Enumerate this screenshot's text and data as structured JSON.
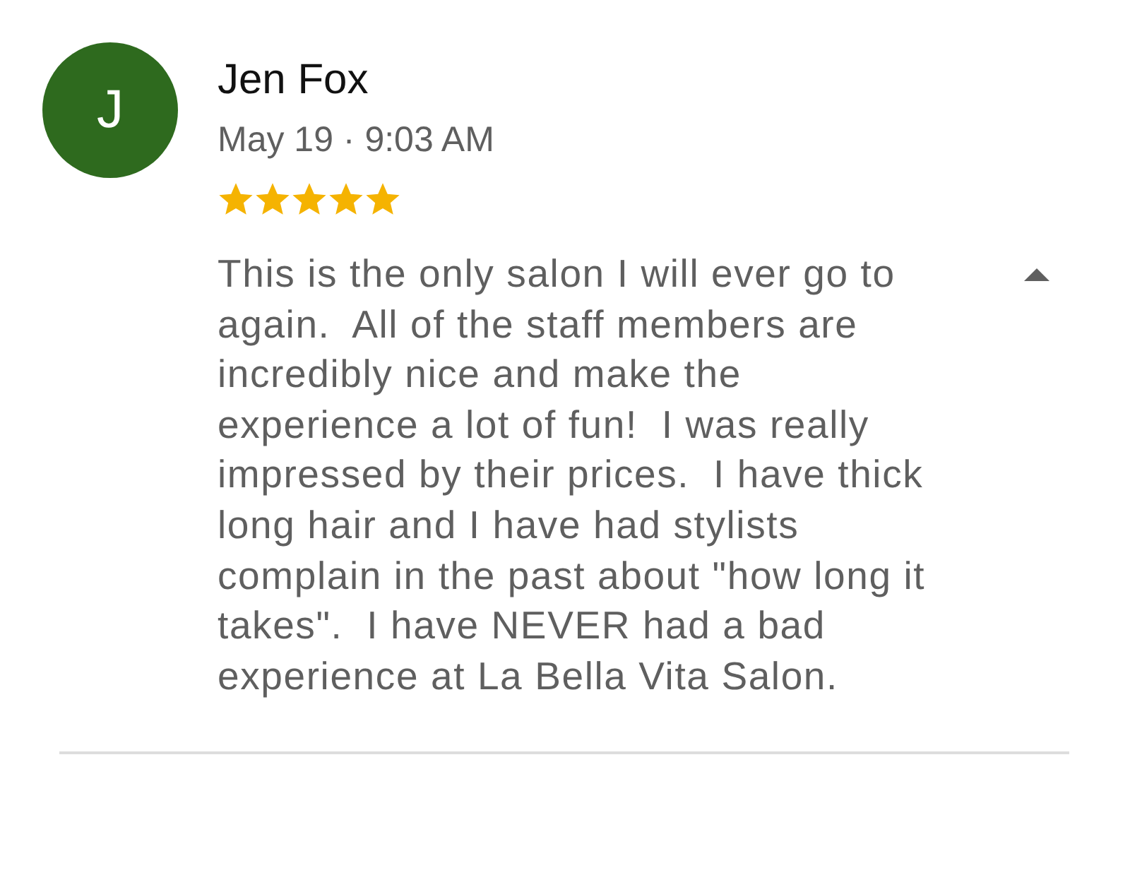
{
  "review": {
    "avatar_letter": "J",
    "author": "Jen Fox",
    "date": "May 19 · 9:03 AM",
    "stars": 5,
    "expanded": true,
    "text": "This is the only salon I will ever go to again.  All of the staff members are incredibly nice and make the experience a lot of fun!  I was really impressed by their prices.  I have thick long hair and I have had stylists complain in the past about \"how long it takes\".  I have NEVER had a bad experience at La Bella Vita Salon."
  }
}
